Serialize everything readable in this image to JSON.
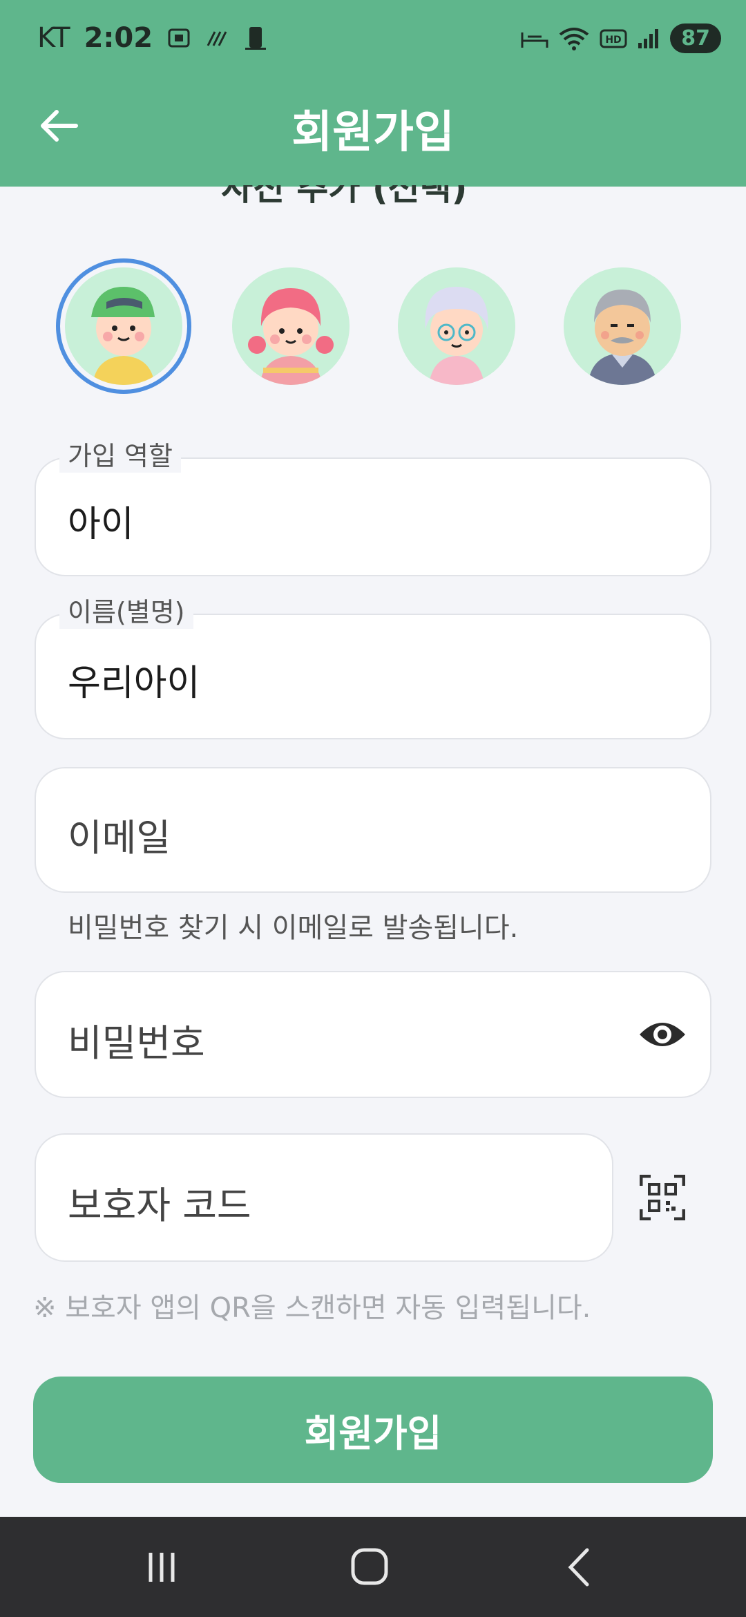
{
  "status_bar": {
    "carrier": "KT",
    "time": "2:02",
    "battery": "87"
  },
  "header": {
    "title": "회원가입"
  },
  "photo_section": {
    "clipped_label": "사진 추가 (선택)"
  },
  "avatars": [
    {
      "name": "아이 (boy)"
    },
    {
      "name": "아이 (girl)"
    },
    {
      "name": "할머니"
    },
    {
      "name": "할아버지"
    }
  ],
  "form": {
    "role": {
      "legend": "가입 역할",
      "value": "아이"
    },
    "nickname": {
      "legend": "이름(별명)",
      "value": "우리아이"
    },
    "email": {
      "placeholder": "이메일",
      "helper": "비밀번호 찾기 시 이메일로 발송됩니다."
    },
    "password": {
      "placeholder": "비밀번호"
    },
    "guardian_code": {
      "placeholder": "보호자 코드",
      "note": "※ 보호자 앱의 QR을 스캔하면 자동 입력됩니다."
    }
  },
  "submit_label": "회원가입",
  "colors": {
    "primary": "#5fb68c",
    "selected_ring": "#4f8fe0",
    "background": "#f4f5f9"
  },
  "icons": [
    "back-arrow-icon",
    "visibility-eye-icon",
    "qr-scan-icon",
    "recents-icon",
    "home-icon",
    "nav-back-icon"
  ]
}
